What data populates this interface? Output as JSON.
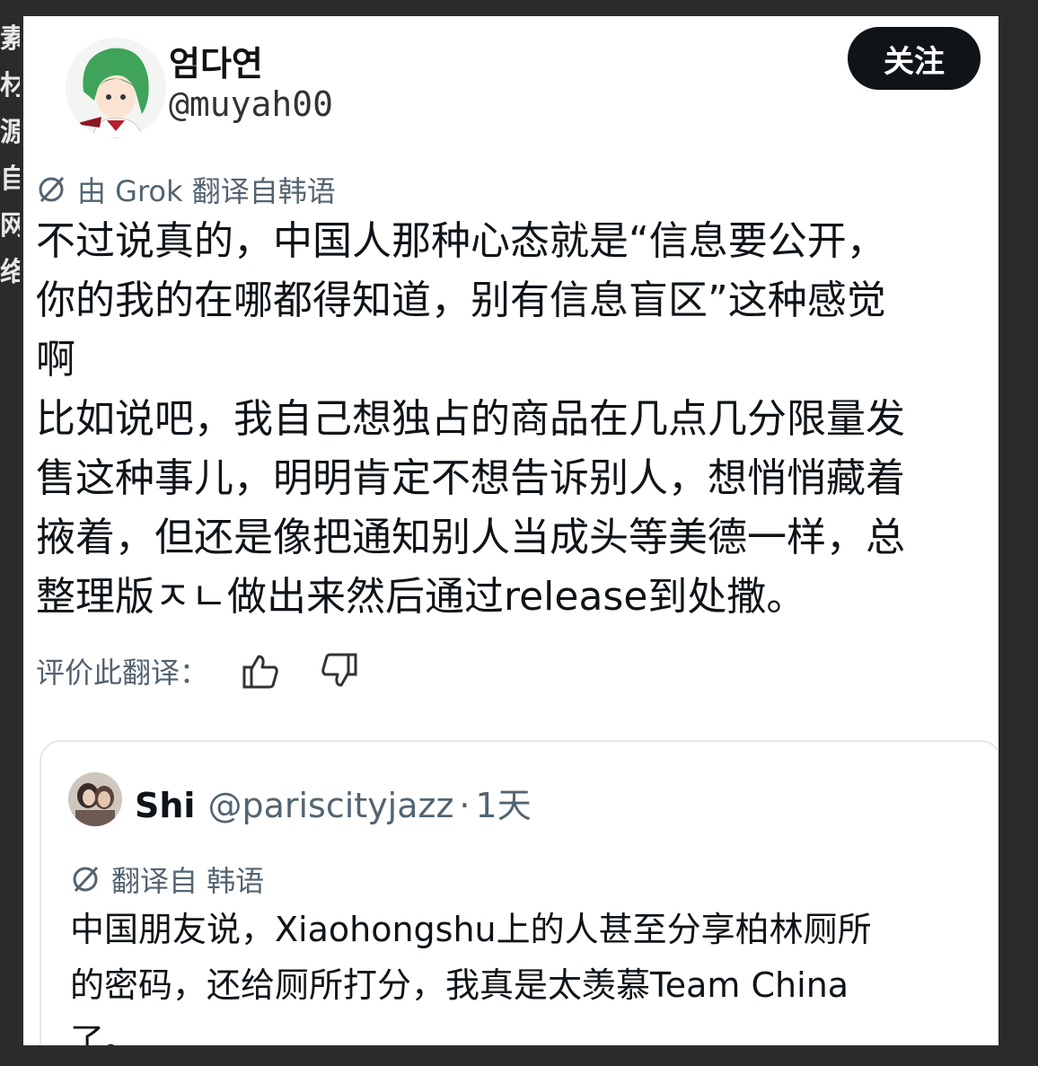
{
  "watermark": "素材源自网络",
  "post": {
    "display_name": "엄다연",
    "handle": "@muyah00",
    "follow_label": "关注",
    "translation_note": "由 Grok 翻译自韩语",
    "text": "不过说真的，中国人那种心态就是“信息要公开，\n你的我的在哪都得知道，别有信息盲区”这种感觉\n啊\n比如说吧，我自己想独占的商品在几点几分限量发\n售这种事儿，明明肯定不想告诉别人，想悄悄藏着\n掖着，但还是像把通知别人当成头等美德一样，总\n整理版ㅈㄴ做出来然后通过release到处撒。",
    "rate_label": "评价此翻译：",
    "icons": {
      "translate": "translate-icon",
      "thumbs_up": "thumbs-up-icon",
      "thumbs_down": "thumbs-down-icon"
    }
  },
  "quote": {
    "name": "Shi",
    "handle": "@pariscityjazz",
    "separator": "·",
    "time": "1天",
    "translation_note": "翻译自 韩语",
    "text": "中国朋友说，Xiaohongshu上的人甚至分享柏林厕所\n的密码，还给厕所打分，我真是太羡慕Team China\n了。"
  },
  "colors": {
    "follow_button": "#0f1419",
    "secondary_text": "#536471",
    "primary_text": "#0f1419"
  }
}
